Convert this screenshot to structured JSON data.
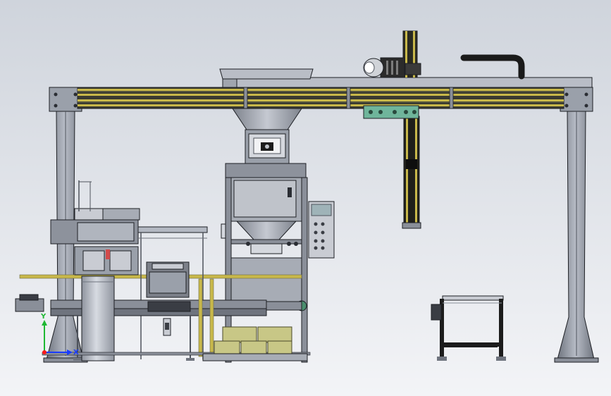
{
  "viewport": {
    "background_top": "#cfd4dc",
    "background_bottom": "#f3f4f7"
  },
  "colors": {
    "steel": "#8a8f99",
    "steel_light": "#b3b8c2",
    "steel_dark": "#4e535c",
    "outline": "#1d1f24",
    "yellow_rail": "#c8b84a",
    "olive_box": "#c8c786",
    "teal_plate": "#6fb59b",
    "black_part": "#1c1c1c",
    "panel": "#c9ccd3",
    "display": "#9fb3b8",
    "axis_x": "#1a3cff",
    "axis_y": "#1fb833",
    "axis_z": "#ff1a1a"
  },
  "axes": {
    "x_label": "X",
    "y_label": "Y",
    "z_label": "Z"
  }
}
